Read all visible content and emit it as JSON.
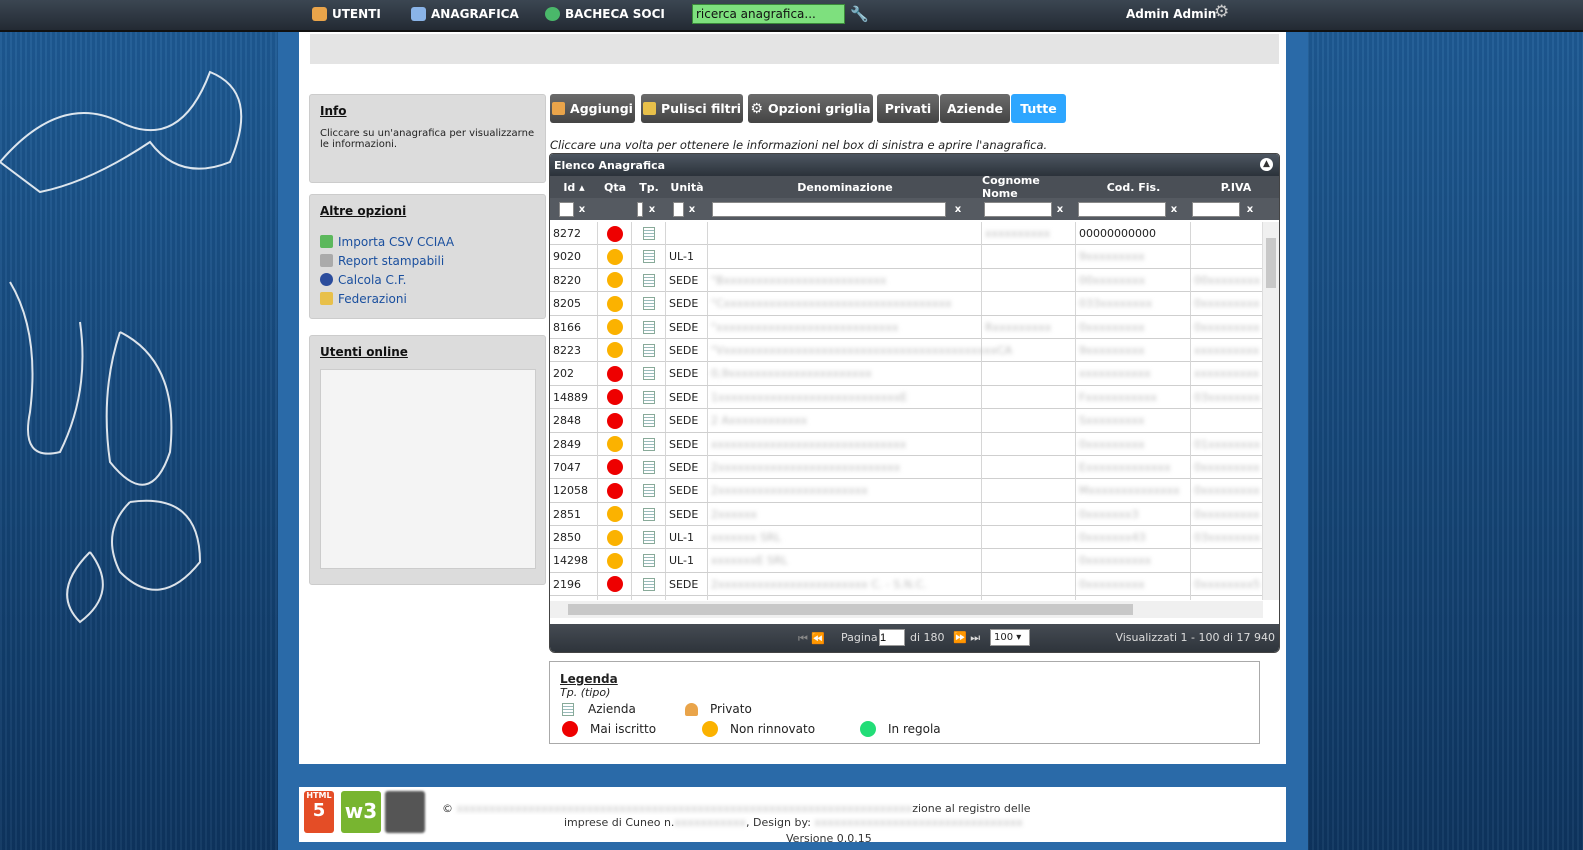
{
  "nav": {
    "utenti": "UTENTI",
    "anagrafica": "ANAGRAFICA",
    "bacheca": "BACHECA SOCI",
    "search_value": "ricerca anagrafica...",
    "admin": "Admin Admin"
  },
  "info": {
    "title": "Info",
    "text": "Cliccare su un'anagrafica per visualizzarne le informazioni."
  },
  "options": {
    "title": "Altre opzioni",
    "items": [
      "Importa CSV CCIAA",
      "Report stampabili",
      "Calcola C.F.",
      "Federazioni"
    ]
  },
  "online": {
    "title": "Utenti online"
  },
  "toolbar": {
    "aggiungi": "Aggiungi",
    "pulisci": "Pulisci filtri",
    "opzioni": "Opzioni griglia",
    "privati": "Privati",
    "aziende": "Aziende",
    "tutte": "Tutte"
  },
  "hint": "Cliccare una volta per ottenere le informazioni nel box di sinistra e aprire l'anagrafica.",
  "grid": {
    "title": "Elenco Anagrafica",
    "columns": {
      "id": "Id",
      "qta": "Qta",
      "tp": "Tp.",
      "unita": "Unità",
      "den": "Denominazione",
      "cogn": "Cognome Nome",
      "cf": "Cod. Fis.",
      "piva": "P.IVA"
    },
    "filter_x": "x",
    "rows": [
      {
        "id": "8272",
        "qta": "red",
        "unita": "",
        "den": "",
        "cogn": "xxxxxxxxxx",
        "cf": "00000000000",
        "piva": ""
      },
      {
        "id": "9020",
        "qta": "ora",
        "unita": "UL-1",
        "den": "",
        "cogn": "",
        "cf": "9xxxxxxxxx",
        "piva": ""
      },
      {
        "id": "8220",
        "qta": "ora",
        "unita": "SEDE",
        "den": "\"Bxxxxxxxxxxxxxxxxxxxxxxxxx",
        "cogn": "",
        "cf": "00xxxxxxxx",
        "piva": "00xxxxxxxx"
      },
      {
        "id": "8205",
        "qta": "ora",
        "unita": "SEDE",
        "den": "\"Cxxxxxxxxxxxxxxxxxxxxxxxxxxxxxxxxxxx",
        "cogn": "",
        "cf": "033xxxxxxxx",
        "piva": "0xxxxxxxxx"
      },
      {
        "id": "8166",
        "qta": "ora",
        "unita": "SEDE",
        "den": "\"xxxxxxxxxxxxxxxxxxxxxxxxxxxx",
        "cogn": "Rxxxxxxxxx",
        "cf": "0xxxxxxxxx",
        "piva": "0xxxxxxxxx"
      },
      {
        "id": "8223",
        "qta": "ora",
        "unita": "SEDE",
        "den": "\"VxxxxxxxxxxxxxxxxxxxxxxxxxxxxxxxxxxxxxxxxxxCA",
        "cogn": "",
        "cf": "9xxxxxxxxx",
        "piva": "xxxxxxxxxx"
      },
      {
        "id": "202",
        "qta": "red",
        "unita": "SEDE",
        "den": "0,9xxxxxxxxxxxxxxxxxxxxxx",
        "cogn": "",
        "cf": "xxxxxxxxxxx",
        "piva": "xxxxxxxxxx"
      },
      {
        "id": "14889",
        "qta": "red",
        "unita": "SEDE",
        "den": "1xxxxxxxxxxxxxxxxxxxxxxxxxxxxE",
        "cogn": "",
        "cf": "Fxxxxxxxxxxx",
        "piva": "03xxxxxxxx"
      },
      {
        "id": "2848",
        "qta": "red",
        "unita": "SEDE",
        "den": "2 Axxxxxxxxxxxx",
        "cogn": "",
        "cf": "Sxxxxxxxxx",
        "piva": ""
      },
      {
        "id": "2849",
        "qta": "ora",
        "unita": "SEDE",
        "den": "xxxxxxxxxxxxxxxxxxxxxxxxxxxxxx",
        "cogn": "",
        "cf": "0xxxxxxxxx",
        "piva": "01xxxxxxxx"
      },
      {
        "id": "7047",
        "qta": "red",
        "unita": "SEDE",
        "den": "2xxxxxxxxxxxxxxxxxxxxxxxxxxxx",
        "cogn": "",
        "cf": "Exxxxxxxxxxxxx",
        "piva": "0xxxxxxxxx"
      },
      {
        "id": "12058",
        "qta": "red",
        "unita": "SEDE",
        "den": "2xxxxxxxxxxxxxxxxxxxxxxx",
        "cogn": "",
        "cf": "Mxxxxxxxxxxxxxx",
        "piva": "0xxxxxxxxx"
      },
      {
        "id": "2851",
        "qta": "ora",
        "unita": "SEDE",
        "den": "2xxxxxx",
        "cogn": "",
        "cf": "0xxxxxxx3",
        "piva": "0xxxxxxxxx"
      },
      {
        "id": "2850",
        "qta": "ora",
        "unita": "UL-1",
        "den": "xxxxxxx SRL",
        "cogn": "",
        "cf": "0xxxxxxx43",
        "piva": "03xxxxxxxx"
      },
      {
        "id": "14298",
        "qta": "ora",
        "unita": "UL-1",
        "den": "xxxxxxxE SRL",
        "cogn": "",
        "cf": "0xxxxxxxxxx",
        "piva": ""
      },
      {
        "id": "2196",
        "qta": "red",
        "unita": "SEDE",
        "den": "2xxxxxxxxxxxxxxxxxxxxxxx C. - S.N.C.",
        "cogn": "",
        "cf": "0xxxxxxxxx",
        "piva": "0xxxxxxxx5"
      },
      {
        "id": "",
        "qta": "red",
        "unita": "",
        "den": "",
        "cogn": "",
        "cf": "",
        "piva": ""
      }
    ],
    "pager": {
      "pagina": "Pagina",
      "page": "1",
      "di": "di 180",
      "size": "100",
      "visual": "Visualizzati 1 - 100 di 17 940"
    }
  },
  "legend": {
    "title": "Legenda",
    "subtitle": "Tp. (tipo)",
    "azienda": "Azienda",
    "privato": "Privato",
    "mai": "Mai iscritto",
    "non": "Non rinnovato",
    "regola": "In regola"
  },
  "footer": {
    "line1a": "©",
    "line1b": "xxxxxxxxxxxxxxxxxxxxxxxxxxxxxxxxxxxxxxxxxxxxxxxxxxxxxxxxxxxxxxxxxxxxxx",
    "line1c": "zione al registro delle",
    "line2a": "imprese di Cuneo n.",
    "line2b": "xxxxxxxxxxx",
    "line2c": ", Design by:",
    "line2d": "xxxxxxxxxxxxxxxxxxxxxxxxxxxxxxxx",
    "version": "Versione 0.0.15"
  },
  "colors": {
    "accent": "#2ea6ff",
    "search": "#7ee07e",
    "red": "#e00000",
    "orange": "#fbb200",
    "green": "#22dd77"
  }
}
